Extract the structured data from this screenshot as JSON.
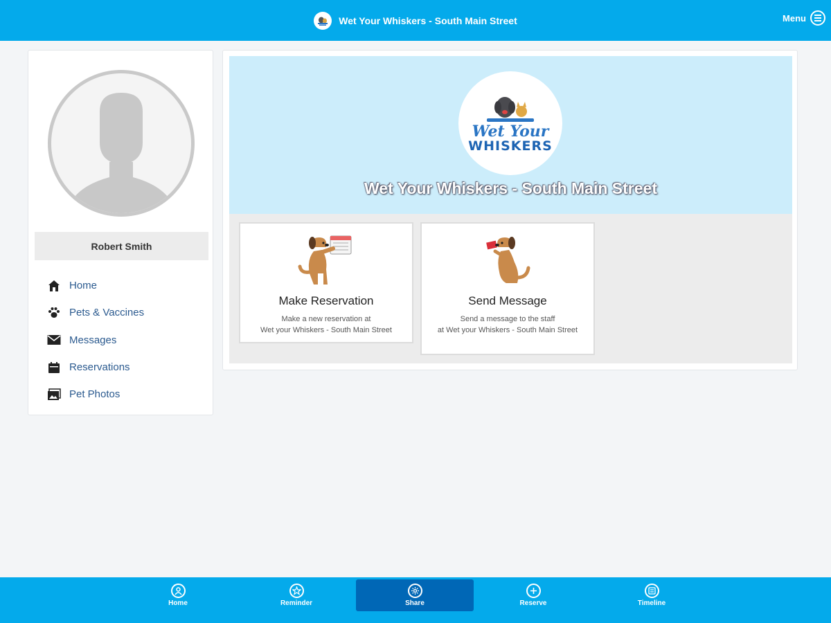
{
  "header": {
    "title": "Wet Your Whiskers - South Main Street",
    "menu_label": "Menu",
    "brand_logo_icon": "dog-cat-logo-icon",
    "menu_icon": "menu-icon"
  },
  "sidebar": {
    "user_name": "Robert Smith",
    "avatar_icon": "user-placeholder-icon",
    "items": [
      {
        "label": "Home",
        "icon": "home-icon"
      },
      {
        "label": "Pets & Vaccines",
        "icon": "paw-icon"
      },
      {
        "label": "Messages",
        "icon": "envelope-icon"
      },
      {
        "label": "Reservations",
        "icon": "calendar-icon"
      },
      {
        "label": "Pet Photos",
        "icon": "photo-icon"
      }
    ]
  },
  "main": {
    "business_name": "Wet Your Whiskers - South Main Street",
    "logo_text": {
      "line1": "Wet Your",
      "line2": "WHISKERS"
    },
    "actions": [
      {
        "title": "Make Reservation",
        "description_line1": "Make a new reservation at",
        "description_line2": "Wet your Whiskers - South Main Street",
        "icon": "dog-calendar-icon"
      },
      {
        "title": "Send Message",
        "description_line1": "Send a message to the staff",
        "description_line2": "at Wet your Whiskers - South Main Street",
        "icon": "dog-message-icon"
      }
    ]
  },
  "tabbar": {
    "tabs": [
      {
        "label": "Home",
        "icon": "user-circle-icon"
      },
      {
        "label": "Reminder",
        "icon": "star-icon"
      },
      {
        "label": "Share",
        "icon": "share-icon",
        "active": true
      },
      {
        "label": "Reserve",
        "icon": "plus-circle-icon"
      },
      {
        "label": "Timeline",
        "icon": "timeline-icon"
      }
    ]
  },
  "colors": {
    "primary": "#04aaeb",
    "active_tab": "#0067b6",
    "hero_bg": "#ccedfb",
    "nav_text": "#2b5a8f"
  }
}
